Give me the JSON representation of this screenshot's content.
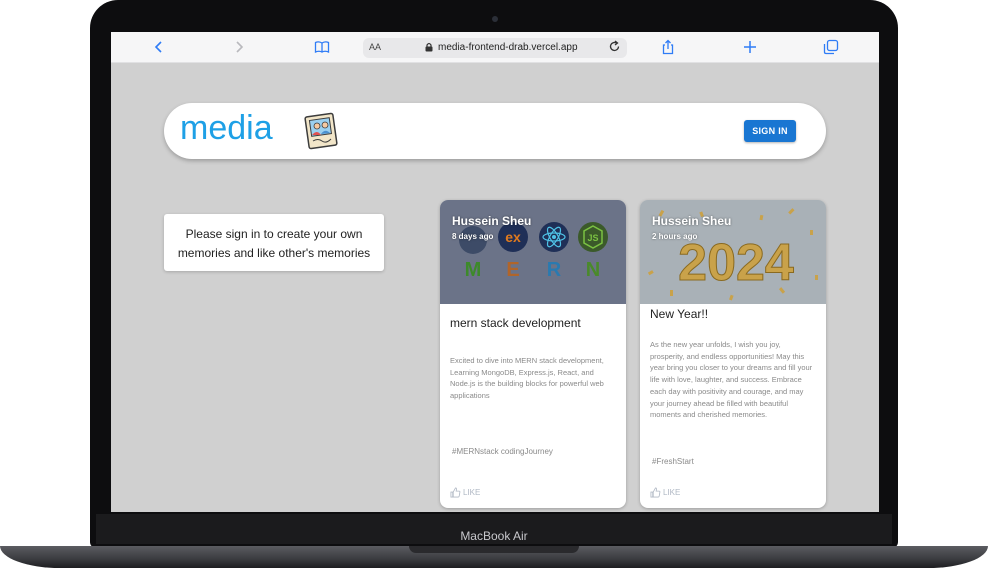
{
  "device": {
    "label": "MacBook Air"
  },
  "browser": {
    "text_size_label": "AA",
    "url": "media-frontend-drab.vercel.app"
  },
  "app": {
    "brand": "media",
    "signin_label": "SIGN IN"
  },
  "signin_prompt": "Please sign in to create your own memories and like other's memories",
  "posts": [
    {
      "author": "Hussein Sheu",
      "time": "8 days ago",
      "image_letters": [
        "M",
        "E",
        "R",
        "N"
      ],
      "image_badges": [
        "ex"
      ],
      "title": "mern stack development",
      "message": "Excited to dive into MERN stack development, Learning MongoDB, Express.js, React, and Node.js is the building blocks for powerful web applications",
      "tags": "#MERNstack codingJourney",
      "like_label": "LIKE"
    },
    {
      "author": "Hussein Sheu",
      "time": "2 hours ago",
      "image_text": "2024",
      "title": "New Year!!",
      "message": "As the new year unfolds, I wish you joy, prosperity, and endless opportunities! May this year bring you closer to your dreams and fill your life with love, laughter, and success. Embrace each day with positivity and courage, and may your journey ahead be filled with beautiful moments and cherished memories.",
      "tags": "#FreshStart",
      "like_label": "LIKE"
    }
  ],
  "colors": {
    "brand": "#1ea0e6",
    "button": "#1976d2",
    "page_bg": "#d0d0d0",
    "browser_accent": "#2f7cf6"
  }
}
